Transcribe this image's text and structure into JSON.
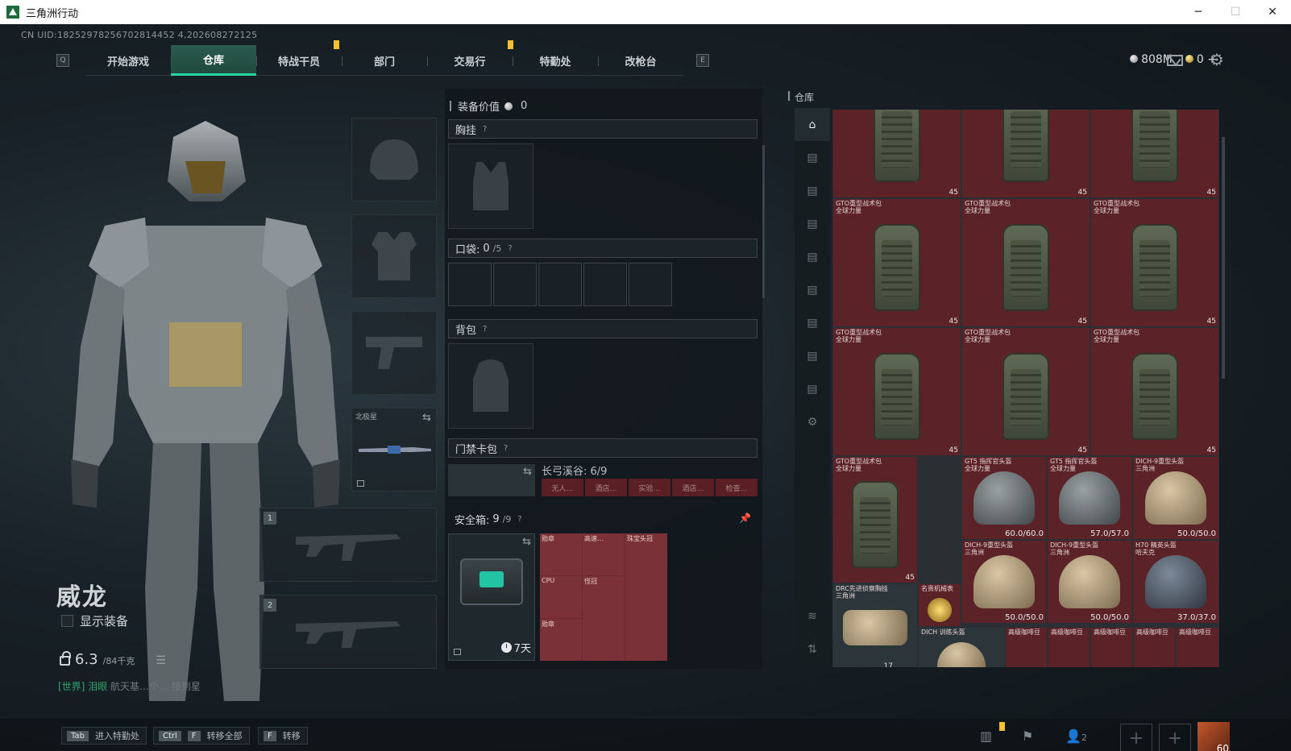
{
  "window": {
    "title": "三角洲行动",
    "minimize": "─",
    "maximize": "☐",
    "close": "✕"
  },
  "uid": "CN UID:18252978256702814452 4,202608272125",
  "nav": {
    "left_key": "Q",
    "right_key": "E",
    "tabs": [
      "开始游戏",
      "仓库",
      "特战干员",
      "部门",
      "交易行",
      "特勤处",
      "改枪台"
    ],
    "active_index": 1
  },
  "currency": {
    "silver": "808M",
    "gold": "0",
    "gold_plus": "+"
  },
  "operator": {
    "name": "威龙",
    "show_equipment": "显示装备",
    "weight": "6.3",
    "weight_max": "/84千克",
    "chat_tag": "[世界]",
    "chat_user": "泪眼",
    "chat_msg": "航天基…个… 接到星"
  },
  "equip_slots": {
    "secondary_label": "北极星",
    "primary1": "1",
    "primary2": "2"
  },
  "gear": {
    "value_label": "装备价值",
    "value": "0",
    "chest_rig": "胸挂",
    "pockets": "口袋:",
    "pockets_count": "0",
    "pockets_max": "/5",
    "backpack": "背包",
    "keycard": "门禁卡包",
    "key_area": "长弓溪谷: 6/9",
    "key_items": [
      "无人…",
      "酒店…",
      "实验…",
      "酒店…",
      "检查…"
    ],
    "safe": "安全箱:",
    "safe_count": "9",
    "safe_max": "/9",
    "safe_timer": "7天",
    "help": "?",
    "safe_items": [
      "勋章",
      "高速…",
      "珠宝头冠",
      "CPU",
      "怪冠",
      "",
      "勋章",
      "",
      ""
    ]
  },
  "warehouse": {
    "title": "仓库",
    "rows": [
      [
        {
          "name": "",
          "sub": "",
          "count": "45"
        },
        {
          "name": "",
          "sub": "",
          "count": "45"
        },
        {
          "name": "",
          "sub": "",
          "count": "45"
        }
      ],
      [
        {
          "name": "GTO重型战术包",
          "sub": "全球力量",
          "count": "45"
        },
        {
          "name": "GTO重型战术包",
          "sub": "全球力量",
          "count": "45"
        },
        {
          "name": "GTO重型战术包",
          "sub": "全球力量",
          "count": "45"
        }
      ],
      [
        {
          "name": "GTO重型战术包",
          "sub": "全球力量",
          "count": "45"
        },
        {
          "name": "GTO重型战术包",
          "sub": "全球力量",
          "count": "45"
        },
        {
          "name": "GTO重型战术包",
          "sub": "全球力量",
          "count": "45"
        }
      ]
    ],
    "gto_bottom": {
      "name": "GTO重型战术包",
      "sub": "全球力量",
      "count": "45"
    },
    "helmets": [
      {
        "name": "GT5 指挥官头盔",
        "sub": "全球力量",
        "dur": "60.0/60.0"
      },
      {
        "name": "GT5 指挥官头盔",
        "sub": "全球力量",
        "dur": "57.0/57.0"
      },
      {
        "name": "DICH-9重型头盔",
        "sub": "三角洲",
        "dur": "50.0/50.0"
      },
      {
        "name": "DICH-9重型头盔",
        "sub": "三角洲",
        "dur": "50.0/50.0"
      },
      {
        "name": "DICH-9重型头盔",
        "sub": "三角洲",
        "dur": "50.0/50.0"
      },
      {
        "name": "H70 精英头盔",
        "sub": "哈夫克",
        "dur": "37.0/37.0"
      }
    ],
    "drc": {
      "name": "DRC先进侦察胸挂",
      "sub": "三角洲",
      "count": "17"
    },
    "watch": {
      "name": "名贵机械表"
    },
    "dich_train": {
      "name": "DICH 训练头盔"
    },
    "coffee": "高级咖啡豆"
  },
  "bottom": {
    "hint1_key": "Tab",
    "hint1": "进入特勤处",
    "hint2_key": "Ctrl",
    "hint2_key2": "F",
    "hint2": "转移全部",
    "hint3_key": "F",
    "hint3": "转移",
    "friends": "2",
    "level": "60"
  }
}
